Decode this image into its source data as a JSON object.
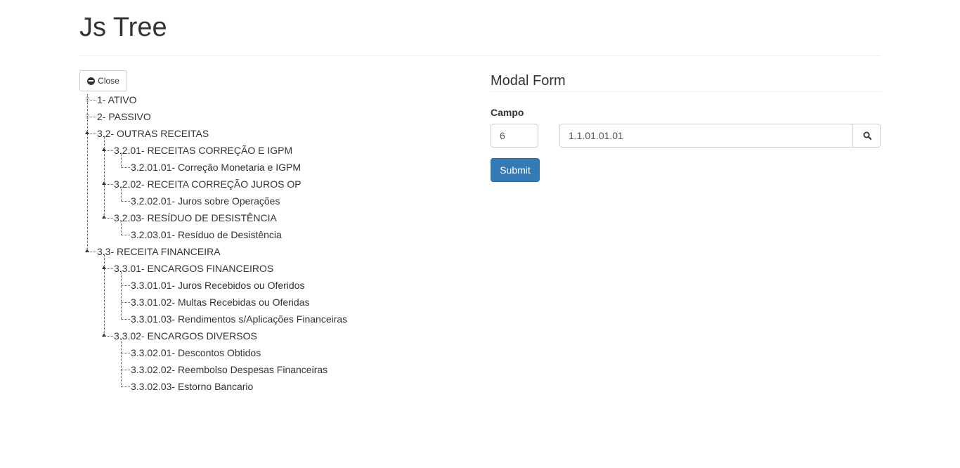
{
  "page": {
    "title": "Js Tree"
  },
  "tree": {
    "close_label": "Close",
    "nodes": [
      {
        "label": "1- ATIVO",
        "level": 0,
        "state": "closed"
      },
      {
        "label": "2- PASSIVO",
        "level": 0,
        "state": "closed"
      },
      {
        "label": "3.2- OUTRAS RECEITAS",
        "level": 0,
        "state": "open"
      },
      {
        "label": "3.2.01- RECEITAS CORREÇÃO E IGPM",
        "level": 1,
        "state": "open"
      },
      {
        "label": "3.2.01.01- Correção Monetaria e IGPM",
        "level": 2,
        "state": "leaf"
      },
      {
        "label": "3.2.02- RECEITA CORREÇÃO JUROS OP",
        "level": 1,
        "state": "open"
      },
      {
        "label": "3.2.02.01- Juros sobre Operações",
        "level": 2,
        "state": "leaf"
      },
      {
        "label": "3.2.03- RESÍDUO DE DESISTÊNCIA",
        "level": 1,
        "state": "open"
      },
      {
        "label": "3.2.03.01- Resíduo de Desistência",
        "level": 2,
        "state": "leaf"
      },
      {
        "label": "3.3- RECEITA FINANCEIRA",
        "level": 0,
        "state": "open"
      },
      {
        "label": "3.3.01- ENCARGOS FINANCEIROS",
        "level": 1,
        "state": "open"
      },
      {
        "label": "3.3.01.01- Juros Recebidos ou Oferidos",
        "level": 2,
        "state": "leaf"
      },
      {
        "label": "3.3.01.02- Multas Recebidas ou Oferidas",
        "level": 2,
        "state": "leaf"
      },
      {
        "label": "3.3.01.03- Rendimentos s/Aplicações Financeiras",
        "level": 2,
        "state": "leaf"
      },
      {
        "label": "3.3.02- ENCARGOS DIVERSOS",
        "level": 1,
        "state": "open"
      },
      {
        "label": "3.3.02.01- Descontos Obtidos",
        "level": 2,
        "state": "leaf"
      },
      {
        "label": "3.3.02.02- Reembolso Despesas Financeiras",
        "level": 2,
        "state": "leaf"
      },
      {
        "label": "3.3.02.03- Estorno Bancario",
        "level": 2,
        "state": "leaf"
      }
    ]
  },
  "form": {
    "title": "Modal Form",
    "field_label": "Campo",
    "code_value": "6",
    "account_value": "1.1.01.01.01",
    "search_icon": "search-icon",
    "submit_label": "Submit"
  },
  "colors": {
    "primary": "#337ab7",
    "border": "#cccccc",
    "text": "#333333"
  }
}
